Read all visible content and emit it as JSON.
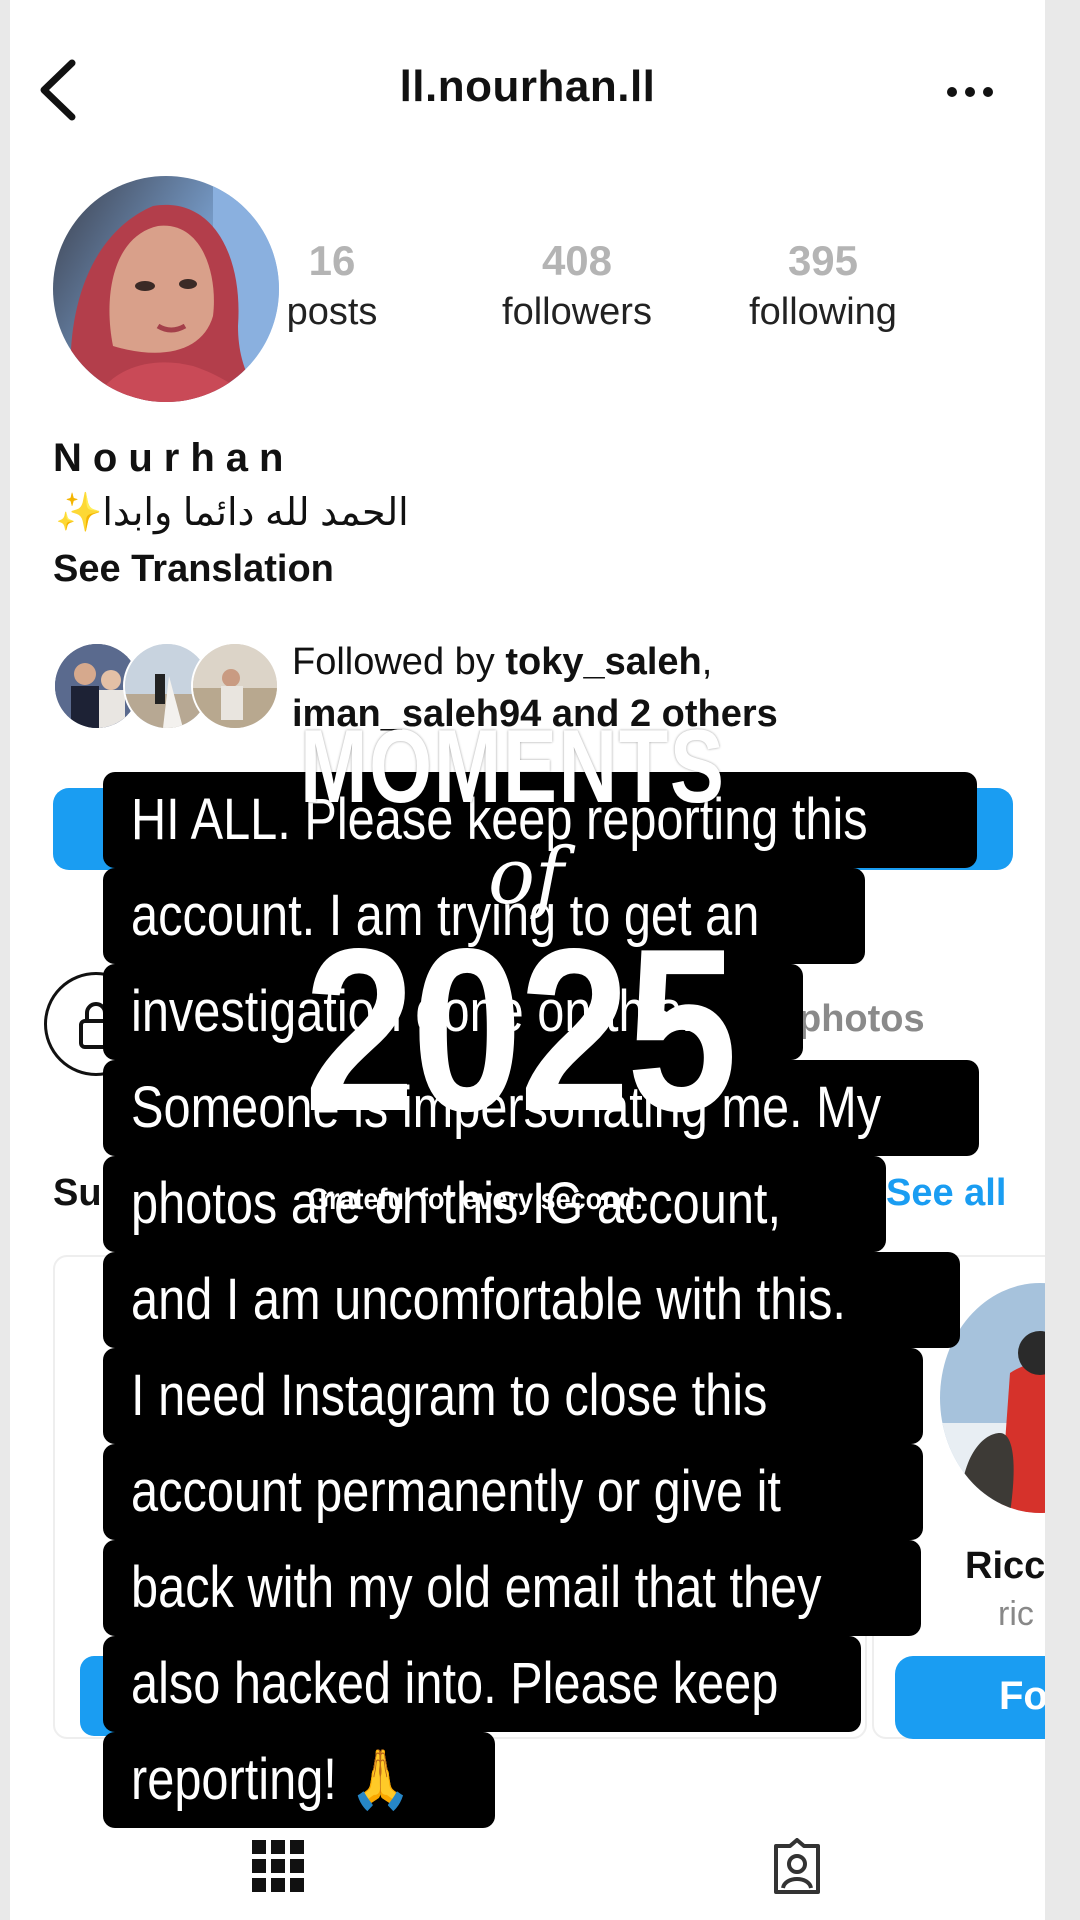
{
  "header": {
    "username": "ll.nourhan.ll",
    "back_icon": "chevron-left-icon",
    "more_icon": "more-horizontal-icon"
  },
  "profile": {
    "stats": [
      {
        "value": "16",
        "label": "posts"
      },
      {
        "value": "408",
        "label": "followers"
      },
      {
        "value": "395",
        "label": "following"
      }
    ],
    "display_name": "Nourhan",
    "bio": "✨الحمد لله دائما وابدا",
    "see_translation": "See Translation"
  },
  "followed_by": {
    "prefix": "Followed by ",
    "user1": "toky_saleh",
    "separator": ",",
    "user2": "iman_saleh94",
    "suffix": " and 2 others"
  },
  "private_section": {
    "photos_text": "photos",
    "lock_icon": "lock-icon"
  },
  "suggested": {
    "label": "Su",
    "see_all": "See all",
    "card_name": "Ricc",
    "card_handle": "ric",
    "card_button": "Fo"
  },
  "tabs": {
    "grid_icon": "grid-icon",
    "tagged_icon": "tagged-icon"
  },
  "overlay": {
    "lines": [
      "HI ALL. Please keep reporting this",
      "account. I am trying to get an",
      "investigation done on this.",
      "Someone is impersonating me. My",
      "photos are on this IG account,",
      "and I am uncomfortable with this.",
      "I need Instagram to close this",
      "account permanently or give it",
      "back with my old email that they",
      "also hacked into. Please keep",
      "reporting! 🙏"
    ],
    "sticker_title": "MOMENTS",
    "sticker_of": "of",
    "sticker_year": "2025",
    "sticker_caption": "Grateful for every second."
  },
  "colors": {
    "accent": "#1a9df2",
    "overlay_bg": "#000000"
  }
}
